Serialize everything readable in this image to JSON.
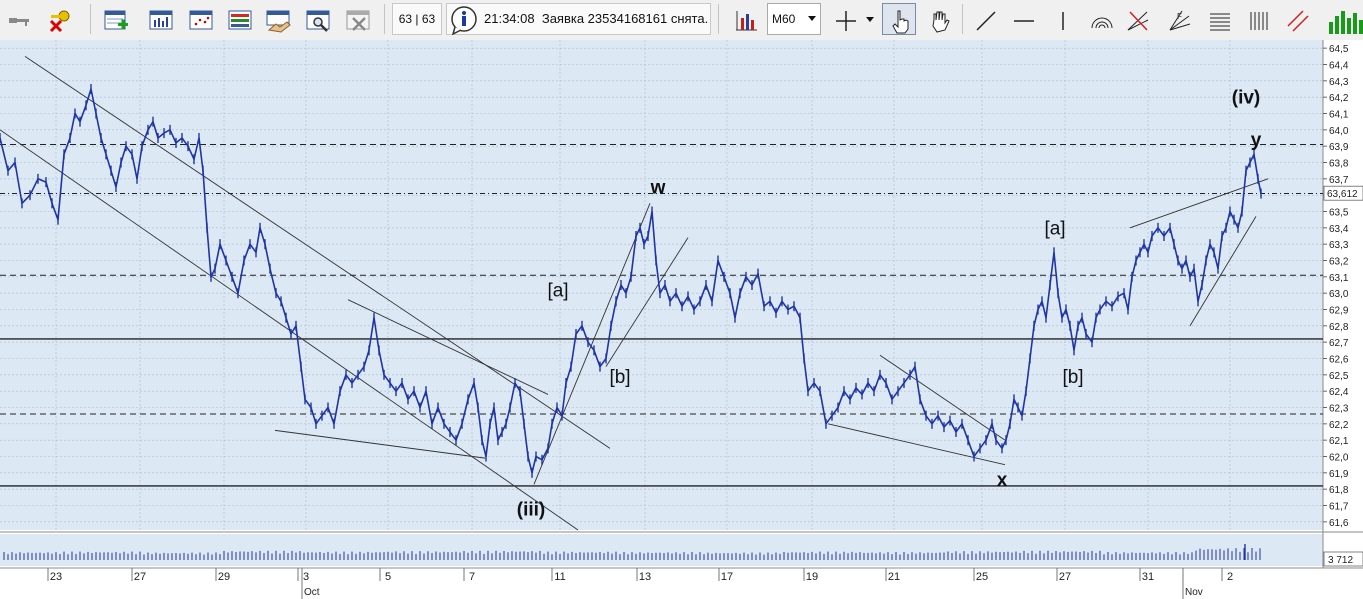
{
  "toolbar": {
    "buttons": [
      {
        "name": "keys-icon"
      },
      {
        "name": "delete-key-icon"
      },
      {
        "name": "new-table-icon"
      },
      {
        "name": "bar-table-icon"
      },
      {
        "name": "scatter-table-icon"
      },
      {
        "name": "list-table-icon"
      },
      {
        "name": "handshake-table-icon"
      },
      {
        "name": "search-table-icon"
      },
      {
        "name": "close-table-icon"
      }
    ],
    "counter": "63 | 63",
    "status_time": "21:34:08",
    "status_message": "Заявка 23534168161 снята.",
    "timeframe": "M60",
    "tools": [
      {
        "name": "indicators-icon"
      },
      {
        "name": "crosshair-icon"
      },
      {
        "name": "hand-pointer-icon",
        "pressed": true
      },
      {
        "name": "hand-pan-icon"
      },
      {
        "name": "line-tool-icon"
      },
      {
        "name": "horizontal-line-icon"
      },
      {
        "name": "vertical-line-icon"
      },
      {
        "name": "arc-tool-icon"
      },
      {
        "name": "fan-tool-icon"
      },
      {
        "name": "fib-fan-icon"
      },
      {
        "name": "fib-levels-icon"
      },
      {
        "name": "cycle-lines-icon"
      },
      {
        "name": "channel-tool-icon"
      },
      {
        "name": "bar-volume-icon"
      }
    ]
  },
  "chart_data": {
    "type": "line",
    "colors": {
      "background": "#dce8f4",
      "price": "#1f35a5",
      "grid": "#a9bcd0",
      "trendline": "#333333",
      "level": "#222222"
    },
    "ylim": [
      61.55,
      64.55
    ],
    "y_ticks": [
      "64,5",
      "64,4",
      "64,3",
      "64,2",
      "64,1",
      "64,0",
      "63,9",
      "63,8",
      "63,7",
      "63,6",
      "63,5",
      "63,4",
      "63,3",
      "63,2",
      "63,1",
      "63,0",
      "62,9",
      "62,8",
      "62,7",
      "62,6",
      "62,5",
      "62,4",
      "62,3",
      "62,2",
      "62,1",
      "62,0",
      "61,9",
      "61,8",
      "61,7",
      "61,6"
    ],
    "y_tick_values": [
      64.5,
      64.4,
      64.3,
      64.2,
      64.1,
      64.0,
      63.9,
      63.8,
      63.7,
      63.6,
      63.5,
      63.4,
      63.3,
      63.2,
      63.1,
      63.0,
      62.9,
      62.8,
      62.7,
      62.6,
      62.5,
      62.4,
      62.3,
      62.2,
      62.1,
      62.0,
      61.9,
      61.8,
      61.7,
      61.6
    ],
    "x_range": [
      0,
      1323
    ],
    "x_ticks": [
      {
        "label": "23",
        "x": 56
      },
      {
        "label": "27",
        "x": 140
      },
      {
        "label": "29",
        "x": 224
      },
      {
        "label": "3",
        "x": 306
      },
      {
        "label": "5",
        "x": 388
      },
      {
        "label": "7",
        "x": 472
      },
      {
        "label": "11",
        "x": 560
      },
      {
        "label": "13",
        "x": 645
      },
      {
        "label": "17",
        "x": 727
      },
      {
        "label": "19",
        "x": 812
      },
      {
        "label": "21",
        "x": 894
      },
      {
        "label": "25",
        "x": 982
      },
      {
        "label": "27",
        "x": 1065
      },
      {
        "label": "31",
        "x": 1148
      },
      {
        "label": "2",
        "x": 1230
      }
    ],
    "month_labels": [
      {
        "label": "Oct",
        "x": 302
      },
      {
        "label": "Nov",
        "x": 1183
      }
    ],
    "last_price": "63,612",
    "last_price_value": 63.612,
    "volume_last": "3 712",
    "horizontal_levels": [
      {
        "value": 61.82,
        "style": "solid"
      },
      {
        "value": 62.72,
        "style": "solid"
      },
      {
        "value": 63.91,
        "style": "dashed"
      },
      {
        "value": 63.11,
        "style": "dashed"
      },
      {
        "value": 62.26,
        "style": "dashed"
      },
      {
        "value": 63.61,
        "style": "dashdot"
      }
    ],
    "price_series": [
      [
        0,
        63.95
      ],
      [
        8,
        63.75
      ],
      [
        15,
        63.8
      ],
      [
        22,
        63.55
      ],
      [
        30,
        63.6
      ],
      [
        38,
        63.7
      ],
      [
        46,
        63.68
      ],
      [
        52,
        63.55
      ],
      [
        58,
        63.45
      ],
      [
        64,
        63.85
      ],
      [
        70,
        63.95
      ],
      [
        75,
        64.1
      ],
      [
        80,
        64.05
      ],
      [
        86,
        64.15
      ],
      [
        91,
        64.25
      ],
      [
        96,
        64.1
      ],
      [
        101,
        63.95
      ],
      [
        106,
        63.85
      ],
      [
        111,
        63.75
      ],
      [
        116,
        63.65
      ],
      [
        121,
        63.8
      ],
      [
        126,
        63.9
      ],
      [
        132,
        63.85
      ],
      [
        137,
        63.7
      ],
      [
        142,
        63.9
      ],
      [
        148,
        64.0
      ],
      [
        153,
        64.05
      ],
      [
        158,
        63.95
      ],
      [
        164,
        63.98
      ],
      [
        170,
        64.0
      ],
      [
        176,
        63.92
      ],
      [
        182,
        63.95
      ],
      [
        188,
        63.9
      ],
      [
        194,
        63.82
      ],
      [
        199,
        63.95
      ],
      [
        203,
        63.75
      ],
      [
        207,
        63.4
      ],
      [
        211,
        63.1
      ],
      [
        215,
        63.15
      ],
      [
        220,
        63.3
      ],
      [
        226,
        63.2
      ],
      [
        232,
        63.1
      ],
      [
        238,
        63.0
      ],
      [
        244,
        63.2
      ],
      [
        250,
        63.3
      ],
      [
        256,
        63.25
      ],
      [
        260,
        63.4
      ],
      [
        265,
        63.3
      ],
      [
        270,
        63.15
      ],
      [
        276,
        63.0
      ],
      [
        281,
        62.95
      ],
      [
        286,
        62.85
      ],
      [
        291,
        62.75
      ],
      [
        296,
        62.8
      ],
      [
        301,
        62.55
      ],
      [
        305,
        62.35
      ],
      [
        311,
        62.3
      ],
      [
        316,
        62.2
      ],
      [
        322,
        62.25
      ],
      [
        328,
        62.3
      ],
      [
        334,
        62.2
      ],
      [
        340,
        62.4
      ],
      [
        346,
        62.5
      ],
      [
        352,
        62.45
      ],
      [
        358,
        62.5
      ],
      [
        364,
        62.55
      ],
      [
        369,
        62.65
      ],
      [
        374,
        62.85
      ],
      [
        379,
        62.65
      ],
      [
        384,
        62.5
      ],
      [
        390,
        62.45
      ],
      [
        396,
        62.4
      ],
      [
        402,
        62.45
      ],
      [
        408,
        62.35
      ],
      [
        414,
        62.4
      ],
      [
        420,
        62.3
      ],
      [
        426,
        62.4
      ],
      [
        432,
        62.2
      ],
      [
        438,
        62.3
      ],
      [
        444,
        62.2
      ],
      [
        450,
        62.15
      ],
      [
        456,
        62.1
      ],
      [
        462,
        62.2
      ],
      [
        468,
        62.35
      ],
      [
        474,
        62.45
      ],
      [
        478,
        62.3
      ],
      [
        482,
        62.1
      ],
      [
        486,
        62.0
      ],
      [
        490,
        62.2
      ],
      [
        494,
        62.3
      ],
      [
        498,
        62.1
      ],
      [
        502,
        62.15
      ],
      [
        506,
        62.2
      ],
      [
        510,
        62.3
      ],
      [
        515,
        62.45
      ],
      [
        520,
        62.4
      ],
      [
        524,
        62.2
      ],
      [
        528,
        62.0
      ],
      [
        532,
        61.9
      ],
      [
        536,
        62.0
      ],
      [
        542,
        61.98
      ],
      [
        548,
        62.05
      ],
      [
        552,
        62.2
      ],
      [
        557,
        62.3
      ],
      [
        562,
        62.25
      ],
      [
        566,
        62.45
      ],
      [
        571,
        62.55
      ],
      [
        576,
        62.75
      ],
      [
        582,
        62.8
      ],
      [
        588,
        62.7
      ],
      [
        594,
        62.65
      ],
      [
        600,
        62.55
      ],
      [
        606,
        62.6
      ],
      [
        611,
        62.8
      ],
      [
        616,
        62.95
      ],
      [
        621,
        63.05
      ],
      [
        626,
        63.0
      ],
      [
        631,
        63.1
      ],
      [
        636,
        63.35
      ],
      [
        640,
        63.4
      ],
      [
        644,
        63.3
      ],
      [
        648,
        63.35
      ],
      [
        652,
        63.5
      ],
      [
        656,
        63.2
      ],
      [
        660,
        63.0
      ],
      [
        665,
        63.05
      ],
      [
        670,
        62.95
      ],
      [
        676,
        63.0
      ],
      [
        682,
        62.92
      ],
      [
        688,
        62.98
      ],
      [
        694,
        62.9
      ],
      [
        700,
        62.95
      ],
      [
        706,
        63.05
      ],
      [
        712,
        62.95
      ],
      [
        718,
        63.2
      ],
      [
        724,
        63.1
      ],
      [
        730,
        63.0
      ],
      [
        735,
        62.85
      ],
      [
        740,
        63.0
      ],
      [
        746,
        63.1
      ],
      [
        752,
        63.05
      ],
      [
        758,
        63.12
      ],
      [
        764,
        62.92
      ],
      [
        770,
        62.95
      ],
      [
        776,
        62.88
      ],
      [
        782,
        62.95
      ],
      [
        788,
        62.9
      ],
      [
        794,
        62.92
      ],
      [
        800,
        62.85
      ],
      [
        804,
        62.6
      ],
      [
        808,
        62.4
      ],
      [
        814,
        62.45
      ],
      [
        820,
        62.4
      ],
      [
        826,
        62.2
      ],
      [
        832,
        62.25
      ],
      [
        838,
        62.3
      ],
      [
        844,
        62.4
      ],
      [
        850,
        62.35
      ],
      [
        856,
        62.42
      ],
      [
        862,
        62.38
      ],
      [
        868,
        62.45
      ],
      [
        874,
        62.4
      ],
      [
        880,
        62.5
      ],
      [
        886,
        62.45
      ],
      [
        892,
        62.35
      ],
      [
        898,
        62.4
      ],
      [
        904,
        62.45
      ],
      [
        910,
        62.5
      ],
      [
        915,
        62.55
      ],
      [
        920,
        62.35
      ],
      [
        926,
        62.25
      ],
      [
        932,
        62.2
      ],
      [
        938,
        62.25
      ],
      [
        944,
        62.18
      ],
      [
        950,
        62.22
      ],
      [
        956,
        62.15
      ],
      [
        962,
        62.2
      ],
      [
        968,
        62.1
      ],
      [
        974,
        62.0
      ],
      [
        980,
        62.05
      ],
      [
        986,
        62.1
      ],
      [
        992,
        62.2
      ],
      [
        996,
        62.1
      ],
      [
        1002,
        62.05
      ],
      [
        1006,
        62.1
      ],
      [
        1010,
        62.2
      ],
      [
        1014,
        62.35
      ],
      [
        1018,
        62.3
      ],
      [
        1022,
        62.25
      ],
      [
        1026,
        62.4
      ],
      [
        1030,
        62.6
      ],
      [
        1034,
        62.8
      ],
      [
        1038,
        62.9
      ],
      [
        1042,
        62.95
      ],
      [
        1046,
        62.85
      ],
      [
        1050,
        63.05
      ],
      [
        1054,
        63.25
      ],
      [
        1058,
        63.0
      ],
      [
        1062,
        62.85
      ],
      [
        1066,
        62.9
      ],
      [
        1070,
        62.8
      ],
      [
        1074,
        62.65
      ],
      [
        1078,
        62.8
      ],
      [
        1082,
        62.85
      ],
      [
        1086,
        62.75
      ],
      [
        1092,
        62.7
      ],
      [
        1096,
        62.85
      ],
      [
        1100,
        62.9
      ],
      [
        1106,
        62.95
      ],
      [
        1112,
        62.92
      ],
      [
        1118,
        62.98
      ],
      [
        1124,
        63.0
      ],
      [
        1128,
        62.9
      ],
      [
        1132,
        63.1
      ],
      [
        1136,
        63.2
      ],
      [
        1140,
        63.25
      ],
      [
        1144,
        63.3
      ],
      [
        1148,
        63.25
      ],
      [
        1152,
        63.35
      ],
      [
        1158,
        63.4
      ],
      [
        1164,
        63.35
      ],
      [
        1170,
        63.4
      ],
      [
        1174,
        63.3
      ],
      [
        1178,
        63.2
      ],
      [
        1182,
        63.15
      ],
      [
        1186,
        63.2
      ],
      [
        1190,
        63.1
      ],
      [
        1194,
        63.15
      ],
      [
        1198,
        62.95
      ],
      [
        1202,
        63.05
      ],
      [
        1206,
        63.2
      ],
      [
        1210,
        63.3
      ],
      [
        1214,
        63.25
      ],
      [
        1218,
        63.15
      ],
      [
        1222,
        63.35
      ],
      [
        1226,
        63.4
      ],
      [
        1230,
        63.5
      ],
      [
        1234,
        63.45
      ],
      [
        1238,
        63.4
      ],
      [
        1242,
        63.5
      ],
      [
        1246,
        63.75
      ],
      [
        1250,
        63.8
      ],
      [
        1254,
        63.85
      ],
      [
        1258,
        63.7
      ],
      [
        1261,
        63.61
      ]
    ],
    "volume": [
      {
        "x": 20,
        "v": 0.55
      },
      {
        "x": 100,
        "v": 0.6
      },
      {
        "x": 180,
        "v": 0.5
      },
      {
        "x": 260,
        "v": 0.7
      },
      {
        "x": 340,
        "v": 0.6
      },
      {
        "x": 420,
        "v": 0.65
      },
      {
        "x": 500,
        "v": 0.7
      },
      {
        "x": 580,
        "v": 0.6
      },
      {
        "x": 660,
        "v": 0.55
      },
      {
        "x": 740,
        "v": 0.5
      },
      {
        "x": 820,
        "v": 0.6
      },
      {
        "x": 900,
        "v": 0.55
      },
      {
        "x": 980,
        "v": 0.65
      },
      {
        "x": 1060,
        "v": 0.7
      },
      {
        "x": 1140,
        "v": 0.55
      },
      {
        "x": 1245,
        "v": 1.0
      }
    ],
    "trendlines": [
      {
        "from": [
          25,
          64.45
        ],
        "to": [
          610,
          62.05
        ]
      },
      {
        "from": [
          0,
          64.0
        ],
        "to": [
          578,
          61.55
        ]
      },
      {
        "from": [
          348,
          62.96
        ],
        "to": [
          548,
          62.38
        ]
      },
      {
        "from": [
          275,
          62.16
        ],
        "to": [
          485,
          61.99
        ]
      },
      {
        "from": [
          534,
          61.83
        ],
        "to": [
          650,
          63.55
        ]
      },
      {
        "from": [
          606,
          62.55
        ],
        "to": [
          688,
          63.34
        ]
      },
      {
        "from": [
          880,
          62.62
        ],
        "to": [
          1005,
          62.1
        ]
      },
      {
        "from": [
          828,
          62.2
        ],
        "to": [
          1005,
          61.95
        ]
      },
      {
        "from": [
          1130,
          63.4
        ],
        "to": [
          1268,
          63.7
        ]
      },
      {
        "from": [
          1190,
          62.8
        ],
        "to": [
          1256,
          63.47
        ]
      }
    ],
    "annotations": [
      {
        "text": "w",
        "x": 658,
        "y": 63.61,
        "style": "bold"
      },
      {
        "text": "[a]",
        "x": 558,
        "y": 62.98,
        "style": "normal"
      },
      {
        "text": "[b]",
        "x": 620,
        "y": 62.45,
        "style": "normal"
      },
      {
        "text": "(iii)",
        "x": 531,
        "y": 61.64,
        "style": "bold"
      },
      {
        "text": "x",
        "x": 1002,
        "y": 61.82,
        "style": "bold"
      },
      {
        "text": "[a]",
        "x": 1055,
        "y": 63.36,
        "style": "normal"
      },
      {
        "text": "[b]",
        "x": 1073,
        "y": 62.45,
        "style": "normal"
      },
      {
        "text": "(iv)",
        "x": 1246,
        "y": 64.16,
        "style": "bold"
      },
      {
        "text": "y",
        "x": 1256,
        "y": 63.9,
        "style": "bold"
      }
    ]
  }
}
